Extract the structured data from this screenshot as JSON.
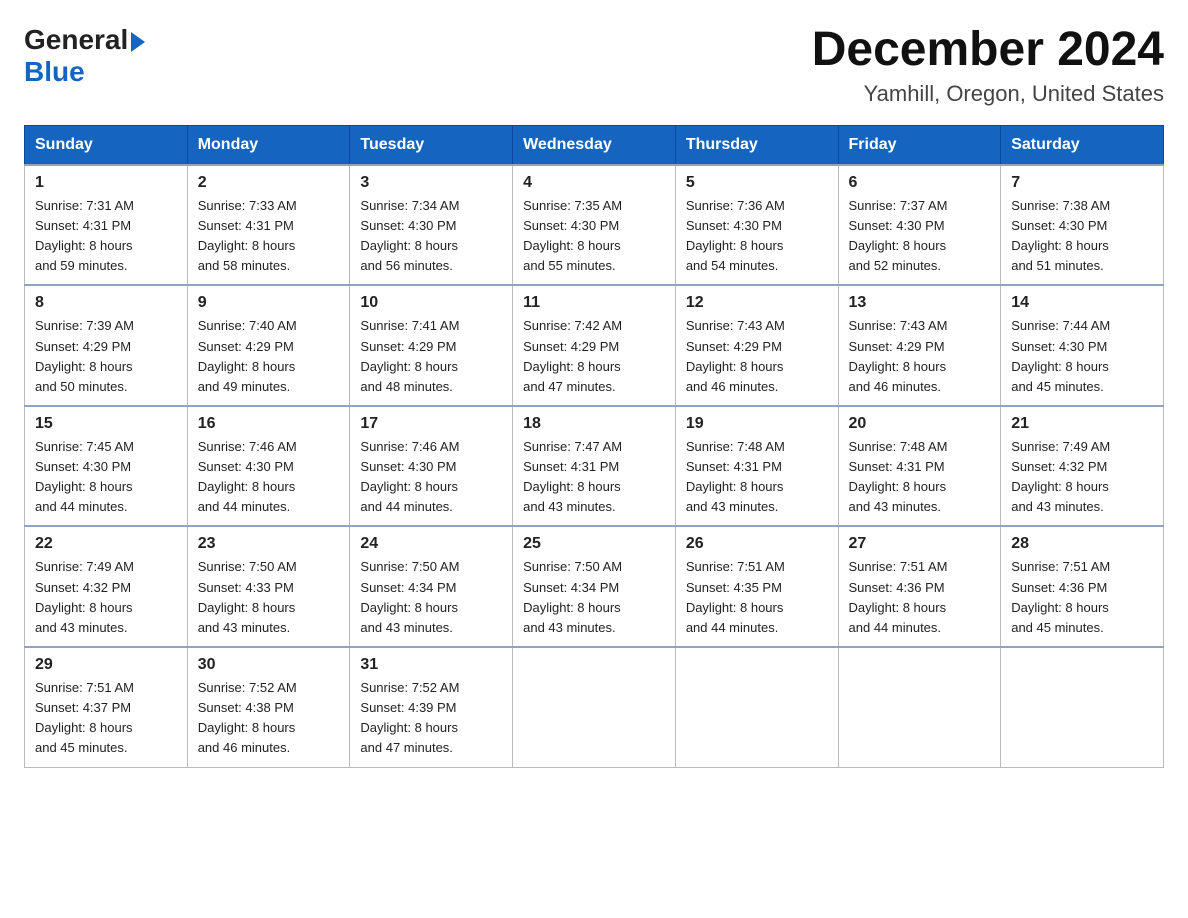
{
  "header": {
    "logo_general": "General",
    "logo_blue": "Blue",
    "month_title": "December 2024",
    "location": "Yamhill, Oregon, United States"
  },
  "weekdays": [
    "Sunday",
    "Monday",
    "Tuesday",
    "Wednesday",
    "Thursday",
    "Friday",
    "Saturday"
  ],
  "weeks": [
    [
      {
        "day": "1",
        "sunrise": "7:31 AM",
        "sunset": "4:31 PM",
        "daylight": "8 hours and 59 minutes."
      },
      {
        "day": "2",
        "sunrise": "7:33 AM",
        "sunset": "4:31 PM",
        "daylight": "8 hours and 58 minutes."
      },
      {
        "day": "3",
        "sunrise": "7:34 AM",
        "sunset": "4:30 PM",
        "daylight": "8 hours and 56 minutes."
      },
      {
        "day": "4",
        "sunrise": "7:35 AM",
        "sunset": "4:30 PM",
        "daylight": "8 hours and 55 minutes."
      },
      {
        "day": "5",
        "sunrise": "7:36 AM",
        "sunset": "4:30 PM",
        "daylight": "8 hours and 54 minutes."
      },
      {
        "day": "6",
        "sunrise": "7:37 AM",
        "sunset": "4:30 PM",
        "daylight": "8 hours and 52 minutes."
      },
      {
        "day": "7",
        "sunrise": "7:38 AM",
        "sunset": "4:30 PM",
        "daylight": "8 hours and 51 minutes."
      }
    ],
    [
      {
        "day": "8",
        "sunrise": "7:39 AM",
        "sunset": "4:29 PM",
        "daylight": "8 hours and 50 minutes."
      },
      {
        "day": "9",
        "sunrise": "7:40 AM",
        "sunset": "4:29 PM",
        "daylight": "8 hours and 49 minutes."
      },
      {
        "day": "10",
        "sunrise": "7:41 AM",
        "sunset": "4:29 PM",
        "daylight": "8 hours and 48 minutes."
      },
      {
        "day": "11",
        "sunrise": "7:42 AM",
        "sunset": "4:29 PM",
        "daylight": "8 hours and 47 minutes."
      },
      {
        "day": "12",
        "sunrise": "7:43 AM",
        "sunset": "4:29 PM",
        "daylight": "8 hours and 46 minutes."
      },
      {
        "day": "13",
        "sunrise": "7:43 AM",
        "sunset": "4:29 PM",
        "daylight": "8 hours and 46 minutes."
      },
      {
        "day": "14",
        "sunrise": "7:44 AM",
        "sunset": "4:30 PM",
        "daylight": "8 hours and 45 minutes."
      }
    ],
    [
      {
        "day": "15",
        "sunrise": "7:45 AM",
        "sunset": "4:30 PM",
        "daylight": "8 hours and 44 minutes."
      },
      {
        "day": "16",
        "sunrise": "7:46 AM",
        "sunset": "4:30 PM",
        "daylight": "8 hours and 44 minutes."
      },
      {
        "day": "17",
        "sunrise": "7:46 AM",
        "sunset": "4:30 PM",
        "daylight": "8 hours and 44 minutes."
      },
      {
        "day": "18",
        "sunrise": "7:47 AM",
        "sunset": "4:31 PM",
        "daylight": "8 hours and 43 minutes."
      },
      {
        "day": "19",
        "sunrise": "7:48 AM",
        "sunset": "4:31 PM",
        "daylight": "8 hours and 43 minutes."
      },
      {
        "day": "20",
        "sunrise": "7:48 AM",
        "sunset": "4:31 PM",
        "daylight": "8 hours and 43 minutes."
      },
      {
        "day": "21",
        "sunrise": "7:49 AM",
        "sunset": "4:32 PM",
        "daylight": "8 hours and 43 minutes."
      }
    ],
    [
      {
        "day": "22",
        "sunrise": "7:49 AM",
        "sunset": "4:32 PM",
        "daylight": "8 hours and 43 minutes."
      },
      {
        "day": "23",
        "sunrise": "7:50 AM",
        "sunset": "4:33 PM",
        "daylight": "8 hours and 43 minutes."
      },
      {
        "day": "24",
        "sunrise": "7:50 AM",
        "sunset": "4:34 PM",
        "daylight": "8 hours and 43 minutes."
      },
      {
        "day": "25",
        "sunrise": "7:50 AM",
        "sunset": "4:34 PM",
        "daylight": "8 hours and 43 minutes."
      },
      {
        "day": "26",
        "sunrise": "7:51 AM",
        "sunset": "4:35 PM",
        "daylight": "8 hours and 44 minutes."
      },
      {
        "day": "27",
        "sunrise": "7:51 AM",
        "sunset": "4:36 PM",
        "daylight": "8 hours and 44 minutes."
      },
      {
        "day": "28",
        "sunrise": "7:51 AM",
        "sunset": "4:36 PM",
        "daylight": "8 hours and 45 minutes."
      }
    ],
    [
      {
        "day": "29",
        "sunrise": "7:51 AM",
        "sunset": "4:37 PM",
        "daylight": "8 hours and 45 minutes."
      },
      {
        "day": "30",
        "sunrise": "7:52 AM",
        "sunset": "4:38 PM",
        "daylight": "8 hours and 46 minutes."
      },
      {
        "day": "31",
        "sunrise": "7:52 AM",
        "sunset": "4:39 PM",
        "daylight": "8 hours and 47 minutes."
      },
      null,
      null,
      null,
      null
    ]
  ],
  "labels": {
    "sunrise_prefix": "Sunrise: ",
    "sunset_prefix": "Sunset: ",
    "daylight_prefix": "Daylight: "
  }
}
